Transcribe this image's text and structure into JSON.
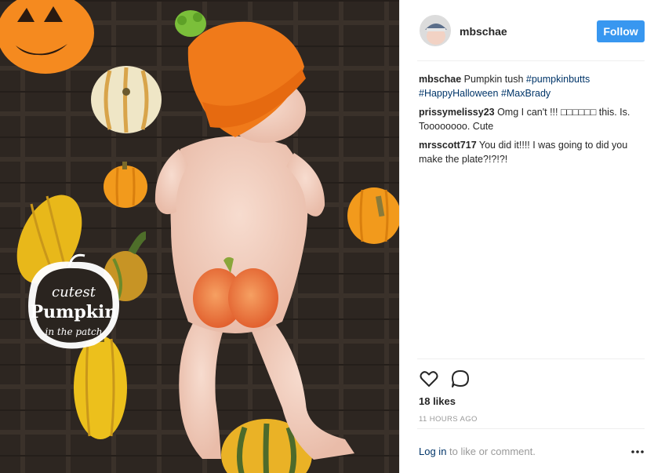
{
  "post": {
    "username": "mbschae",
    "follow_label": "Follow",
    "photo_sticker": {
      "line1": "cutest",
      "line2": "Pumpkin",
      "line3": "in the patch"
    },
    "comments": [
      {
        "author": "mbschae",
        "text": " Pumpkin tush ",
        "tags": [
          "#pumpkinbutts",
          "#HappyHalloween",
          "#MaxBrady"
        ]
      },
      {
        "author": "prissymelissy23",
        "text": " Omg I can't !!! □□□□□□ this. Is. Toooooooo. Cute"
      },
      {
        "author": "mrsscott717",
        "text": " You did it!!!! I was going to did you make the plate?!?!?!"
      }
    ],
    "likes": "18 likes",
    "time": "11 HOURS AGO",
    "login": {
      "link": "Log in",
      "rest": " to like or comment."
    }
  },
  "colors": {
    "accent": "#3897f0",
    "link": "#003569",
    "muted": "#999999"
  },
  "icons": {
    "like": "heart-icon",
    "comment": "speech-bubble-icon",
    "more": "ellipsis-icon"
  }
}
